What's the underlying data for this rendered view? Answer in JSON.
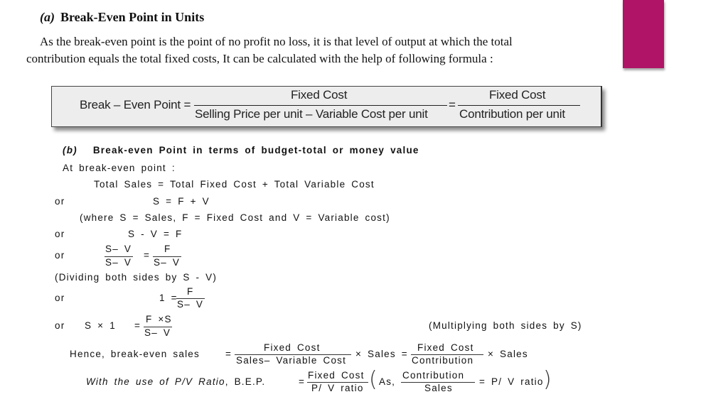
{
  "section_a": {
    "label": "(a)",
    "title": "Break-Even Point in Units",
    "paragraph_line1": "As the break-even point is the point of no profit no loss, it is that level of output at which the total",
    "paragraph_line2": "contribution equals the total fixed costs, It can be calculated with the help of following formula :"
  },
  "formula_box": {
    "lhs": "Break – Even Point =",
    "frac1_num": "Fixed Cost",
    "frac1_den": "Selling Price per unit – Variable Cost per unit",
    "equals": "=",
    "frac2_num": "Fixed Cost",
    "frac2_den": "Contribution per unit"
  },
  "section_b": {
    "label": "(b)",
    "title": "Break-even Point in terms of budget-total or money value",
    "intro": "At break-even point :",
    "eq1": "Total Sales = Total Fixed Cost + Total Variable Cost",
    "or": "or",
    "eq2": "S = F + V",
    "where": "(where S = Sales, F = Fixed Cost and V = Variable cost)",
    "eq3": "S - V = F",
    "eq4_lhs_num": "S– V",
    "eq4_lhs_den": "S– V",
    "eq4_eq": "=",
    "eq4_rhs_num": "F",
    "eq4_rhs_den": "S– V",
    "dividing_note": "(Dividing both sides by S - V)",
    "eq5_lhs": "1 =",
    "eq5_num": "F",
    "eq5_den": "S– V",
    "eq6_lhs": "S × 1",
    "eq6_eq": "=",
    "eq6_num": "F ×S",
    "eq6_den": "S– V",
    "multiplying_note": "(Multiplying both sides by S)",
    "hence_label": "Hence, break-even sales",
    "hence_eq": "=",
    "hence_num1": "Fixed Cost",
    "hence_den1": "Sales– Variable Cost",
    "hence_mid": "× Sales =",
    "hence_num2": "Fixed Cost",
    "hence_den2": "Contribution",
    "hence_end": "× Sales",
    "pv_label": "With the use of P/V Ratio",
    "pv_bep": ", B.E.P.",
    "pv_eq": "=",
    "pv_num": "Fixed Cost",
    "pv_den": "P/ V ratio",
    "pv_as": "As,",
    "pv_num2": "Contribution",
    "pv_den2": "Sales",
    "pv_end": "= P/ V ratio"
  },
  "colors": {
    "accent": "#b01466",
    "formula_box_bg": "#ededed"
  }
}
